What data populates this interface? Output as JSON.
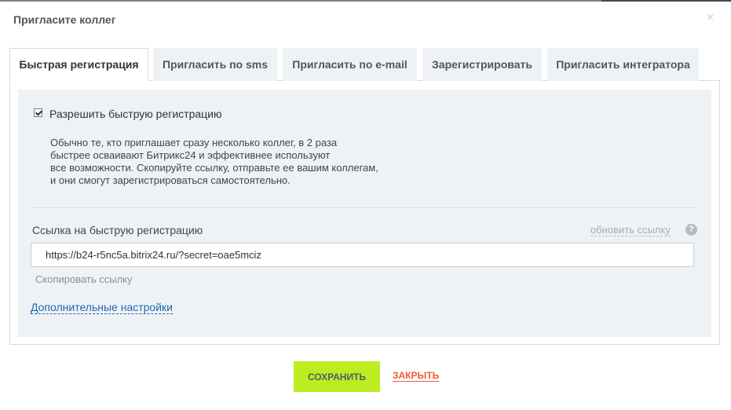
{
  "dialog": {
    "title": "Пригласите коллег",
    "close_glyph": "×"
  },
  "tabs": [
    {
      "label": "Быстрая регистрация",
      "active": true
    },
    {
      "label": "Пригласить по sms",
      "active": false
    },
    {
      "label": "Пригласить по e-mail",
      "active": false
    },
    {
      "label": "Зарегистрировать",
      "active": false
    },
    {
      "label": "Пригласить интегратора",
      "active": false
    }
  ],
  "quick_registration": {
    "checkbox_label": "Разрешить быструю регистрацию",
    "checkbox_checked": true,
    "description_lines": [
      "Обычно те, кто приглашает сразу несколько коллег, в 2 раза",
      "быстрее осваивают Битрикс24 и эффективнее используют",
      "все возможности. Скопируйте ссылку, отправьте ее вашим коллегам,",
      "и они смогут зарегистрироваться самостоятельно."
    ],
    "link_label": "Ссылка на быструю регистрацию",
    "refresh_link": "обновить ссылку",
    "help_glyph": "?",
    "url_value": "https://b24-r5nc5a.bitrix24.ru/?secret=oae5mciz",
    "copy_link": "Скопировать ссылку",
    "more_settings": "Дополнительные настройки"
  },
  "footer": {
    "save_label": "СОХРАНИТЬ",
    "close_label": "ЗАКРЫТЬ"
  },
  "colors": {
    "save_button": "#bbed21",
    "close_link": "#f05a3a",
    "panel_bg": "#eef2f4",
    "link_blue": "#2067b0"
  }
}
